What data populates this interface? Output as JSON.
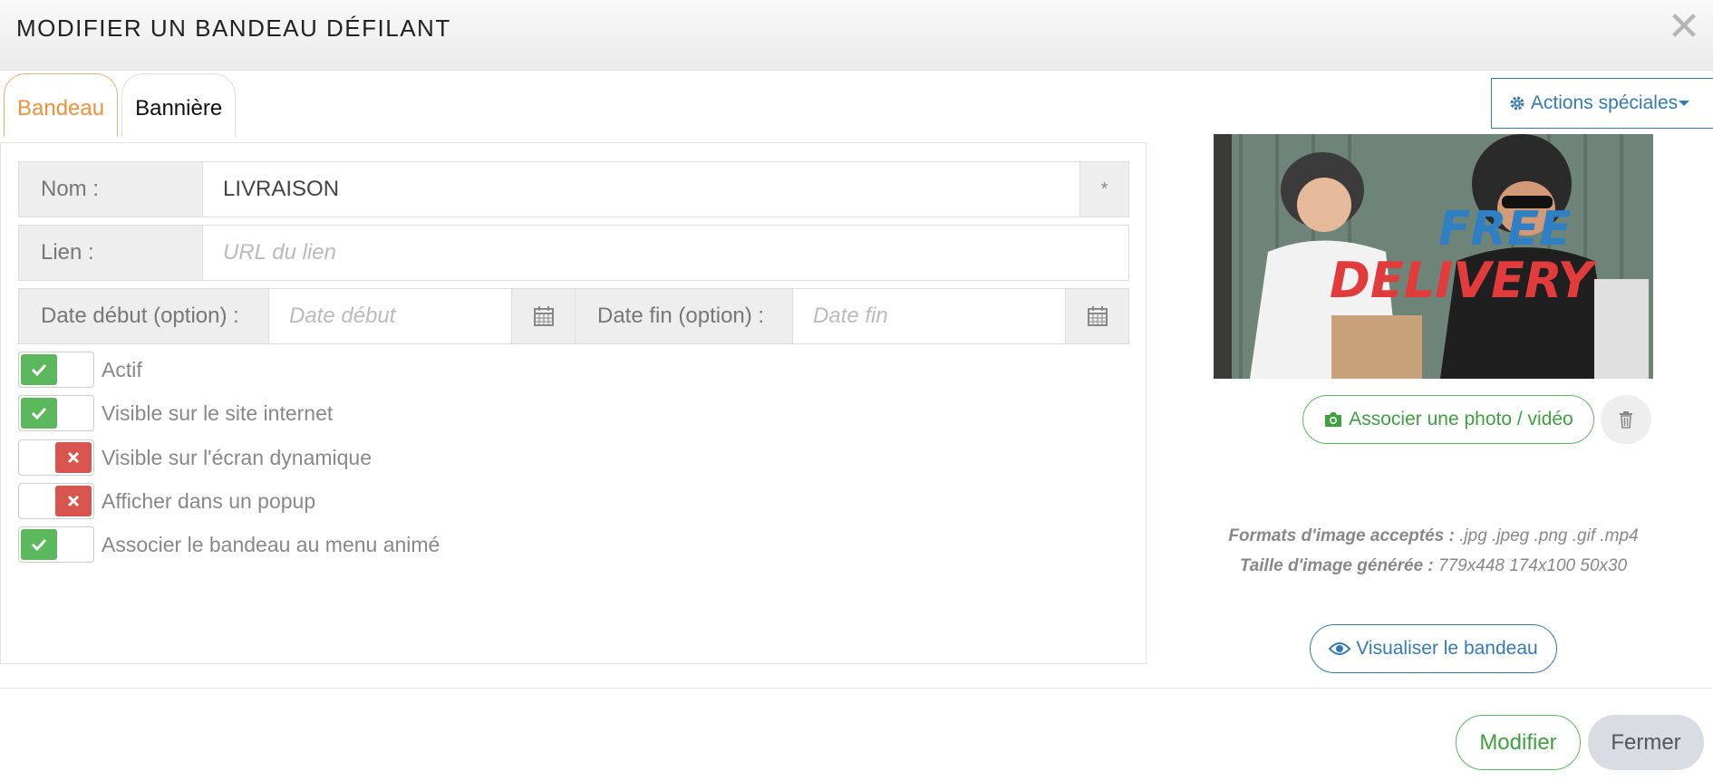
{
  "header": {
    "title": "MODIFIER UN BANDEAU DÉFILANT",
    "close_symbol": "✕"
  },
  "tabs": [
    {
      "label": "Bandeau",
      "active": true
    },
    {
      "label": "Bannière",
      "active": false
    }
  ],
  "special_actions": {
    "label": "Actions spéciales",
    "icon": "gear-icon"
  },
  "form": {
    "name": {
      "label": "Nom :",
      "value": "LIVRAISON",
      "required_mark": "*"
    },
    "link": {
      "label": "Lien :",
      "value": "",
      "placeholder": "URL du lien"
    },
    "start_date": {
      "label": "Date début (option) :",
      "value": "",
      "placeholder": "Date début",
      "icon": "calendar-icon"
    },
    "end_date": {
      "label": "Date fin (option) :",
      "value": "",
      "placeholder": "Date fin",
      "icon": "calendar-icon"
    }
  },
  "toggles": [
    {
      "label": "Actif",
      "on": true
    },
    {
      "label": "Visible sur le site internet",
      "on": true
    },
    {
      "label": "Visible sur l'écran dynamique",
      "on": false
    },
    {
      "label": "Afficher dans un popup",
      "on": false
    },
    {
      "label": "Associer le bandeau au menu animé",
      "on": true
    }
  ],
  "media": {
    "image_text_line1": "FREE",
    "image_text_line2": "DELIVERY",
    "associate_label": "Associer une photo / vidéo",
    "formats_label": "Formats d'image acceptés :",
    "formats_value": ".jpg .jpeg .png .gif .mp4",
    "size_label": "Taille d'image générée :",
    "size_value": "779x448 174x100 50x30",
    "view_label": "Visualiser le bandeau"
  },
  "footer": {
    "modify_label": "Modifier",
    "close_label": "Fermer"
  },
  "colors": {
    "accent_orange": "#f0913a",
    "primary_blue": "#337ab7",
    "success_green": "#5cb85c",
    "danger_red": "#d9534f"
  }
}
